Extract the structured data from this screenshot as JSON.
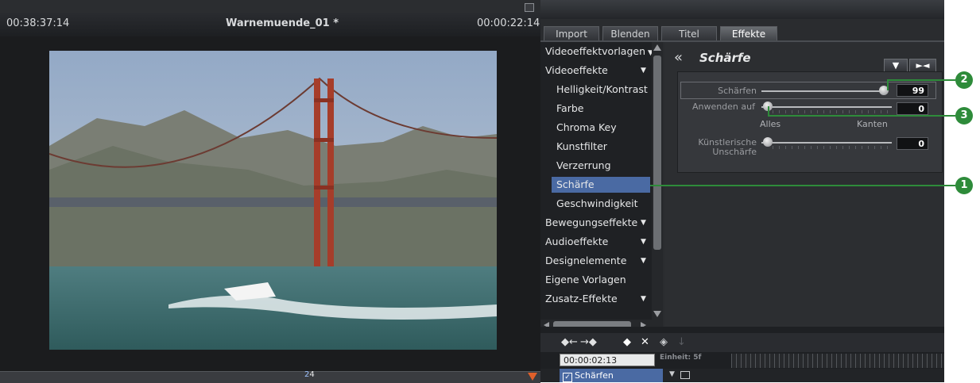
{
  "preview": {
    "timecode_left": "00:38:37:14",
    "project_title": "Warnemuende_01 *",
    "timecode_right": "00:00:22:14",
    "position_marker": "2",
    "position_digits": "4"
  },
  "tabs": [
    {
      "label": "Import",
      "active": false
    },
    {
      "label": "Blenden",
      "active": false
    },
    {
      "label": "Titel",
      "active": false
    },
    {
      "label": "Effekte",
      "active": true
    }
  ],
  "effect_list": {
    "items": [
      {
        "label": "Videoeffektvorlagen",
        "level": 0,
        "expandable": true
      },
      {
        "label": "Videoeffekte",
        "level": 0,
        "expandable": true
      },
      {
        "label": "Helligkeit/Kontrast",
        "level": 1
      },
      {
        "label": "Farbe",
        "level": 1
      },
      {
        "label": "Chroma Key",
        "level": 1
      },
      {
        "label": "Kunstfilter",
        "level": 1
      },
      {
        "label": "Verzerrung",
        "level": 1
      },
      {
        "label": "Schärfe",
        "level": 1,
        "selected": true
      },
      {
        "label": "Geschwindigkeit",
        "level": 1
      },
      {
        "label": "Bewegungseffekte",
        "level": 0,
        "expandable": true
      },
      {
        "label": "Audioeffekte",
        "level": 0,
        "expandable": true
      },
      {
        "label": "Designelemente",
        "level": 0,
        "expandable": true
      },
      {
        "label": "Eigene Vorlagen",
        "level": 0
      },
      {
        "label": "Zusatz-Effekte",
        "level": 0,
        "expandable": true
      }
    ]
  },
  "effect_panel": {
    "back_glyph": "«",
    "title": "Schärfe",
    "menu_button": "▼",
    "collapse_button": "►◄",
    "params": [
      {
        "label": "Schärfen",
        "value": "99",
        "level": 0.99
      },
      {
        "label": "Anwenden auf",
        "value": "0",
        "level": 0.0,
        "min_label": "Alles",
        "max_label": "Kanten"
      },
      {
        "label": "Künstlerische Unschärfe",
        "value": "0",
        "level": 0.0
      }
    ]
  },
  "keyframes": {
    "timecode": "00:00:02:13",
    "unit_label": "Einheit: 5f",
    "track_label": "Schärfen"
  },
  "callouts": [
    "1",
    "2",
    "3"
  ],
  "colors": {
    "accent_green": "#2e8b3a",
    "selection_blue": "#4a6aa3"
  }
}
